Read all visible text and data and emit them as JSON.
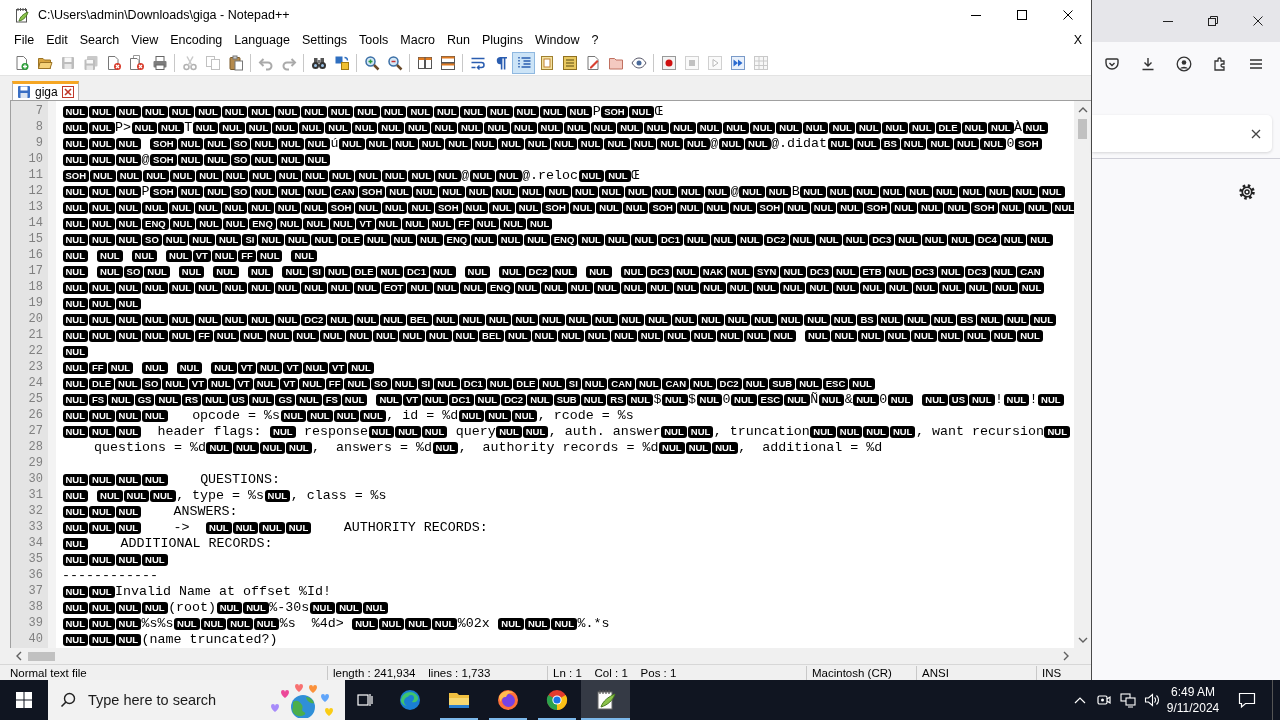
{
  "window": {
    "title": "C:\\Users\\admin\\Downloads\\giga - Notepad++"
  },
  "menu": {
    "items": [
      "File",
      "Edit",
      "Search",
      "View",
      "Encoding",
      "Language",
      "Settings",
      "Tools",
      "Macro",
      "Run",
      "Plugins",
      "Window",
      "?"
    ],
    "close_label": "X"
  },
  "toolbar": [
    {
      "pressed": false,
      "disabled": false
    },
    {
      "pressed": false,
      "disabled": false
    },
    {
      "pressed": false,
      "disabled": true
    },
    {
      "pressed": false,
      "disabled": true
    },
    {
      "pressed": false,
      "disabled": false
    },
    {
      "pressed": false,
      "disabled": false
    },
    {
      "pressed": false,
      "disabled": false
    },
    {
      "pressed": false,
      "disabled": true
    },
    {
      "pressed": false,
      "disabled": true
    },
    {
      "pressed": false,
      "disabled": false
    },
    {
      "pressed": false,
      "disabled": true
    },
    {
      "pressed": false,
      "disabled": true
    },
    {
      "pressed": false,
      "disabled": false
    },
    {
      "pressed": false,
      "disabled": false
    },
    {
      "pressed": false,
      "disabled": false
    },
    {
      "pressed": false,
      "disabled": false
    },
    {
      "pressed": false,
      "disabled": false
    },
    {
      "pressed": false,
      "disabled": false
    },
    {
      "pressed": false,
      "disabled": false
    },
    {
      "pressed": false,
      "disabled": false
    },
    {
      "pressed": true,
      "disabled": false
    },
    {
      "pressed": false,
      "disabled": false
    },
    {
      "pressed": false,
      "disabled": false
    },
    {
      "pressed": false,
      "disabled": false
    },
    {
      "pressed": false,
      "disabled": false
    },
    {
      "pressed": false,
      "disabled": false
    },
    {
      "pressed": false,
      "disabled": false
    },
    {
      "pressed": false,
      "disabled": true
    },
    {
      "pressed": false,
      "disabled": true
    },
    {
      "pressed": false,
      "disabled": false
    },
    {
      "pressed": false,
      "disabled": true
    }
  ],
  "tabs": [
    {
      "label": "giga",
      "selected": true
    }
  ],
  "editor": {
    "lines": [
      {
        "number": "7",
        "segments": [
          {
            "kind": "ctrl",
            "codes": [
              "NUL",
              "NUL",
              "NUL",
              "NUL",
              "NUL",
              "NUL",
              "NUL",
              "NUL",
              "NUL",
              "NUL",
              "NUL",
              "NUL",
              "NUL",
              "NUL",
              "NUL",
              "NUL",
              "NUL",
              "NUL",
              "NUL",
              "NUL"
            ]
          },
          {
            "kind": "text",
            "text": "P"
          },
          {
            "kind": "ctrl",
            "codes": [
              "SOH",
              "NUL"
            ]
          },
          {
            "kind": "text",
            "text": "Œ"
          }
        ]
      },
      {
        "number": "8",
        "segments": [
          {
            "kind": "ctrl",
            "codes": [
              "NUL",
              "NUL"
            ]
          },
          {
            "kind": "text",
            "text": "P>"
          },
          {
            "kind": "ctrl",
            "codes": [
              "NUL",
              "NUL"
            ]
          },
          {
            "kind": "text",
            "text": "T"
          },
          {
            "kind": "ctrl",
            "codes": [
              "NUL",
              "NUL",
              "NUL",
              "NUL",
              "NUL",
              "NUL",
              "NUL",
              "NUL",
              "NUL",
              "NUL",
              "NUL",
              "NUL",
              "NUL",
              "NUL",
              "NUL",
              "NUL",
              "NUL",
              "NUL",
              "NUL",
              "NUL",
              "NUL",
              "NUL",
              "NUL",
              "NUL",
              "NUL",
              "NUL",
              "NUL",
              "NUL",
              "DLE",
              "NUL",
              "NUL"
            ]
          },
          {
            "kind": "text",
            "text": "À"
          },
          {
            "kind": "ctrl",
            "codes": [
              "NUL"
            ]
          }
        ]
      },
      {
        "number": "9",
        "segments": [
          {
            "kind": "ctrl",
            "codes": [
              "NUL",
              "NUL",
              "NUL"
            ]
          },
          {
            "kind": "ctrl",
            "codes": [
              "SOH",
              "NUL",
              "NUL",
              "SO",
              "NUL",
              "NUL",
              "NUL"
            ]
          },
          {
            "kind": "text",
            "text": "ú"
          },
          {
            "kind": "ctrl",
            "codes": [
              "NUL",
              "NUL",
              "NUL",
              "NUL",
              "NUL",
              "NUL",
              "NUL",
              "NUL",
              "NUL",
              "NUL",
              "NUL",
              "NUL",
              "NUL",
              "NUL"
            ]
          },
          {
            "kind": "text",
            "text": "@"
          },
          {
            "kind": "ctrl",
            "codes": [
              "NUL",
              "NUL"
            ]
          },
          {
            "kind": "text",
            "text": "@.didat"
          },
          {
            "kind": "ctrl",
            "codes": [
              "NUL",
              "NUL",
              "BS",
              "NUL",
              "NUL",
              "NUL",
              "NUL"
            ]
          },
          {
            "kind": "text",
            "text": "0"
          },
          {
            "kind": "ctrl",
            "codes": [
              "SOH"
            ]
          }
        ]
      },
      {
        "number": "10",
        "segments": [
          {
            "kind": "ctrl",
            "codes": [
              "NUL",
              "NUL",
              "NUL"
            ]
          },
          {
            "kind": "text",
            "text": "@"
          },
          {
            "kind": "ctrl",
            "codes": [
              "SOH",
              "NUL",
              "NUL",
              "SO",
              "NUL",
              "NUL",
              "NUL"
            ]
          }
        ]
      },
      {
        "number": "11",
        "segments": [
          {
            "kind": "ctrl",
            "codes": [
              "SOH",
              "NUL",
              "NUL",
              "NUL",
              "NUL",
              "NUL",
              "NUL",
              "NUL",
              "NUL",
              "NUL",
              "NUL",
              "NUL",
              "NUL",
              "NUL",
              "NUL"
            ]
          },
          {
            "kind": "text",
            "text": "@"
          },
          {
            "kind": "ctrl",
            "codes": [
              "NUL",
              "NUL"
            ]
          },
          {
            "kind": "text",
            "text": "@.reloc"
          },
          {
            "kind": "ctrl",
            "codes": [
              "NUL",
              "NUL"
            ]
          },
          {
            "kind": "text",
            "text": "Œ"
          }
        ]
      },
      {
        "number": "12",
        "segments": [
          {
            "kind": "ctrl",
            "codes": [
              "NUL",
              "NUL",
              "NUL"
            ]
          },
          {
            "kind": "text",
            "text": "P"
          },
          {
            "kind": "ctrl",
            "codes": [
              "SOH",
              "NUL",
              "NUL",
              "SO",
              "NUL",
              "NUL",
              "NUL",
              "CAN",
              "SOH",
              "NUL",
              "NUL",
              "NUL",
              "NUL",
              "NUL",
              "NUL",
              "NUL",
              "NUL",
              "NUL",
              "NUL",
              "NUL",
              "NUL",
              "NUL"
            ]
          },
          {
            "kind": "text",
            "text": "@"
          },
          {
            "kind": "ctrl",
            "codes": [
              "NUL",
              "NUL"
            ]
          },
          {
            "kind": "text",
            "text": "B"
          },
          {
            "kind": "ctrl",
            "codes": [
              "NUL",
              "NUL",
              "NUL",
              "NUL",
              "NUL",
              "NUL",
              "NUL",
              "NUL",
              "NUL",
              "NUL"
            ]
          }
        ]
      },
      {
        "number": "13",
        "segments": [
          {
            "kind": "ctrl",
            "codes": [
              "NUL",
              "NUL",
              "NUL",
              "NUL",
              "NUL",
              "NUL",
              "NUL",
              "NUL",
              "NUL",
              "NUL",
              "SOH",
              "NUL",
              "NUL",
              "NUL",
              "SOH",
              "NUL",
              "NUL",
              "NUL",
              "SOH",
              "NUL",
              "NUL",
              "NUL",
              "SOH",
              "NUL",
              "NUL",
              "NUL",
              "SOH",
              "NUL",
              "NUL",
              "NUL",
              "SOH",
              "NUL",
              "NUL",
              "NUL",
              "SOH",
              "NUL",
              "NUL",
              "NUL"
            ]
          }
        ]
      },
      {
        "number": "14",
        "segments": [
          {
            "kind": "ctrl",
            "codes": [
              "NUL",
              "NUL",
              "NUL",
              "ENQ",
              "NUL",
              "NUL",
              "NUL",
              "ENQ",
              "NUL",
              "NUL",
              "NUL",
              "VT",
              "NUL",
              "NUL",
              "NUL",
              "FF",
              "NUL",
              "NUL",
              "NUL"
            ]
          }
        ]
      },
      {
        "number": "15",
        "segments": [
          {
            "kind": "ctrl",
            "codes": [
              "NUL",
              "NUL",
              "NUL",
              "SO",
              "NUL",
              "NUL",
              "NUL",
              "SI",
              "NUL",
              "NUL",
              "NUL",
              "DLE",
              "NUL",
              "NUL",
              "NUL",
              "ENQ",
              "NUL",
              "NUL",
              "NUL",
              "ENQ",
              "NUL",
              "NUL",
              "NUL",
              "DC1",
              "NUL",
              "NUL",
              "NUL",
              "DC2",
              "NUL",
              "NUL",
              "NUL",
              "DC3",
              "NUL",
              "NUL",
              "NUL",
              "DC4",
              "NUL",
              "NUL"
            ]
          }
        ]
      },
      {
        "number": "16",
        "segments": [
          {
            "kind": "ctrl",
            "codes": [
              "NUL"
            ]
          },
          {
            "kind": "ctrl",
            "codes": [
              "NUL"
            ]
          },
          {
            "kind": "ctrl",
            "codes": [
              "NUL"
            ]
          },
          {
            "kind": "ctrl",
            "codes": [
              "NUL",
              "VT",
              "NUL",
              "FF",
              "NUL"
            ]
          },
          {
            "kind": "ctrl",
            "codes": [
              "NUL"
            ]
          }
        ]
      },
      {
        "number": "17",
        "segments": [
          {
            "kind": "ctrl",
            "codes": [
              "NUL"
            ]
          },
          {
            "kind": "ctrl",
            "codes": [
              "NUL",
              "SO",
              "NUL"
            ]
          },
          {
            "kind": "ctrl",
            "codes": [
              "NUL"
            ]
          },
          {
            "kind": "ctrl",
            "codes": [
              "NUL"
            ]
          },
          {
            "kind": "ctrl",
            "codes": [
              "NUL"
            ]
          },
          {
            "kind": "ctrl",
            "codes": [
              "NUL",
              "SI",
              "NUL",
              "DLE",
              "NUL",
              "DC1",
              "NUL"
            ]
          },
          {
            "kind": "ctrl",
            "codes": [
              "NUL"
            ]
          },
          {
            "kind": "ctrl",
            "codes": [
              "NUL",
              "DC2",
              "NUL"
            ]
          },
          {
            "kind": "ctrl",
            "codes": [
              "NUL"
            ]
          },
          {
            "kind": "ctrl",
            "codes": [
              "NUL",
              "DC3",
              "NUL",
              "NAK",
              "NUL",
              "SYN",
              "NUL",
              "DC3",
              "NUL",
              "ETB",
              "NUL",
              "DC3",
              "NUL",
              "DC3",
              "NUL",
              "CAN"
            ]
          }
        ]
      },
      {
        "number": "18",
        "segments": [
          {
            "kind": "ctrl",
            "codes": [
              "NUL",
              "NUL",
              "NUL",
              "NUL",
              "NUL",
              "NUL",
              "NUL",
              "NUL",
              "NUL",
              "NUL",
              "NUL",
              "NUL",
              "EOT",
              "NUL",
              "NUL",
              "NUL",
              "ENQ",
              "NUL",
              "NUL",
              "NUL",
              "NUL",
              "NUL",
              "NUL",
              "NUL",
              "NUL",
              "NUL",
              "NUL",
              "NUL",
              "NUL",
              "NUL",
              "NUL",
              "NUL",
              "NUL",
              "NUL",
              "NUL",
              "NUL",
              "NUL"
            ]
          }
        ]
      },
      {
        "number": "19",
        "segments": [
          {
            "kind": "ctrl",
            "codes": [
              "NUL",
              "NUL",
              "NUL"
            ]
          }
        ]
      },
      {
        "number": "20",
        "segments": [
          {
            "kind": "ctrl",
            "codes": [
              "NUL",
              "NUL",
              "NUL",
              "NUL",
              "NUL",
              "NUL",
              "NUL",
              "NUL",
              "NUL",
              "DC2",
              "NUL",
              "NUL",
              "NUL",
              "BEL",
              "NUL",
              "NUL",
              "NUL",
              "NUL",
              "NUL",
              "NUL",
              "NUL",
              "NUL",
              "NUL",
              "NUL",
              "NUL",
              "NUL",
              "NUL",
              "NUL",
              "NUL",
              "NUL",
              "BS",
              "NUL",
              "NUL",
              "NUL",
              "BS",
              "NUL",
              "NUL",
              "NUL"
            ]
          }
        ]
      },
      {
        "number": "21",
        "segments": [
          {
            "kind": "ctrl",
            "codes": [
              "NUL",
              "NUL",
              "NUL",
              "NUL",
              "NUL",
              "FF",
              "NUL",
              "NUL",
              "NUL",
              "NUL",
              "NUL",
              "NUL",
              "NUL",
              "NUL",
              "NUL",
              "NUL",
              "BEL",
              "NUL",
              "NUL",
              "NUL",
              "NUL",
              "NUL",
              "NUL",
              "NUL",
              "NUL",
              "NUL",
              "NUL",
              "NUL"
            ]
          },
          {
            "kind": "ctrl",
            "codes": [
              "NUL",
              "NUL",
              "NUL",
              "NUL",
              "NUL",
              "NUL",
              "NUL",
              "NUL",
              "NUL"
            ]
          }
        ]
      },
      {
        "number": "22",
        "segments": [
          {
            "kind": "ctrl",
            "codes": [
              "NUL"
            ]
          }
        ]
      },
      {
        "number": "23",
        "segments": [
          {
            "kind": "ctrl",
            "codes": [
              "NUL",
              "FF",
              "NUL"
            ]
          },
          {
            "kind": "ctrl",
            "codes": [
              "NUL"
            ]
          },
          {
            "kind": "ctrl",
            "codes": [
              "NUL"
            ]
          },
          {
            "kind": "ctrl",
            "codes": [
              "NUL",
              "VT",
              "NUL",
              "VT",
              "NUL",
              "VT",
              "NUL"
            ]
          }
        ]
      },
      {
        "number": "24",
        "segments": [
          {
            "kind": "ctrl",
            "codes": [
              "NUL",
              "DLE",
              "NUL",
              "SO",
              "NUL",
              "VT",
              "NUL",
              "VT",
              "NUL",
              "VT",
              "NUL",
              "FF",
              "NUL",
              "SO",
              "NUL",
              "SI",
              "NUL",
              "DC1",
              "NUL",
              "DLE",
              "NUL",
              "SI",
              "NUL",
              "CAN",
              "NUL",
              "CAN",
              "NUL",
              "DC2",
              "NUL",
              "SUB",
              "NUL",
              "ESC",
              "NUL"
            ]
          }
        ]
      },
      {
        "number": "25",
        "segments": [
          {
            "kind": "ctrl",
            "codes": [
              "NUL",
              "FS",
              "NUL",
              "GS",
              "NUL",
              "RS",
              "NUL",
              "US",
              "NUL",
              "GS",
              "NUL",
              "FS",
              "NUL"
            ]
          },
          {
            "kind": "ctrl",
            "codes": [
              "NUL",
              "VT",
              "NUL",
              "DC1",
              "NUL",
              "DC2",
              "NUL",
              "SUB",
              "NUL",
              "RS",
              "NUL"
            ]
          },
          {
            "kind": "text",
            "text": "$"
          },
          {
            "kind": "ctrl",
            "codes": [
              "NUL"
            ]
          },
          {
            "kind": "text",
            "text": "$"
          },
          {
            "kind": "ctrl",
            "codes": [
              "NUL"
            ]
          },
          {
            "kind": "text",
            "text": "0"
          },
          {
            "kind": "ctrl",
            "codes": [
              "NUL",
              "ESC",
              "NUL"
            ]
          },
          {
            "kind": "text",
            "text": "Ñ"
          },
          {
            "kind": "ctrl",
            "codes": [
              "NUL"
            ]
          },
          {
            "kind": "text",
            "text": "&"
          },
          {
            "kind": "ctrl",
            "codes": [
              "NUL"
            ]
          },
          {
            "kind": "text",
            "text": "0"
          },
          {
            "kind": "ctrl",
            "codes": [
              "NUL"
            ]
          },
          {
            "kind": "ctrl",
            "codes": [
              "NUL",
              "US",
              "NUL"
            ]
          },
          {
            "kind": "text",
            "text": "!"
          },
          {
            "kind": "ctrl",
            "codes": [
              "NUL"
            ]
          },
          {
            "kind": "text",
            "text": "!"
          },
          {
            "kind": "ctrl",
            "codes": [
              "NUL"
            ]
          }
        ]
      },
      {
        "number": "26",
        "segments": [
          {
            "kind": "ctrl",
            "codes": [
              "NUL",
              "NUL",
              "NUL",
              "NUL"
            ]
          },
          {
            "kind": "text",
            "text": "   opcode = %s"
          },
          {
            "kind": "ctrl",
            "codes": [
              "NUL",
              "NUL",
              "NUL",
              "NUL"
            ]
          },
          {
            "kind": "text",
            "text": ", id = %d"
          },
          {
            "kind": "ctrl",
            "codes": [
              "NUL",
              "NUL",
              "NUL"
            ]
          },
          {
            "kind": "text",
            "text": ", rcode = %s"
          }
        ]
      },
      {
        "number": "27",
        "segments": [
          {
            "kind": "ctrl",
            "codes": [
              "NUL",
              "NUL",
              "NUL"
            ]
          },
          {
            "kind": "text",
            "text": "  header flags: "
          },
          {
            "kind": "ctrl",
            "codes": [
              "NUL"
            ]
          },
          {
            "kind": "text",
            "text": " response"
          },
          {
            "kind": "ctrl",
            "codes": [
              "NUL",
              "NUL",
              "NUL"
            ]
          },
          {
            "kind": "text",
            "text": " query"
          },
          {
            "kind": "ctrl",
            "codes": [
              "NUL",
              "NUL"
            ]
          },
          {
            "kind": "text",
            "text": ", auth. answer"
          },
          {
            "kind": "ctrl",
            "codes": [
              "NUL",
              "NUL"
            ]
          },
          {
            "kind": "text",
            "text": ", truncation"
          },
          {
            "kind": "ctrl",
            "codes": [
              "NUL",
              "NUL",
              "NUL",
              "NUL"
            ]
          },
          {
            "kind": "text",
            "text": ", want recursion"
          },
          {
            "kind": "ctrl",
            "codes": [
              "NUL"
            ]
          }
        ]
      },
      {
        "number": "28",
        "segments": [
          {
            "kind": "text",
            "text": "    questions = %d"
          },
          {
            "kind": "ctrl",
            "codes": [
              "NUL",
              "NUL",
              "NUL",
              "NUL"
            ]
          },
          {
            "kind": "text",
            "text": ",  answers = %d"
          },
          {
            "kind": "ctrl",
            "codes": [
              "NUL"
            ]
          },
          {
            "kind": "text",
            "text": ",  authority records = %d"
          },
          {
            "kind": "ctrl",
            "codes": [
              "NUL",
              "NUL",
              "NUL"
            ]
          },
          {
            "kind": "text",
            "text": ",  additional = %d"
          }
        ]
      },
      {
        "number": "29"
      },
      {
        "number": "30",
        "segments": [
          {
            "kind": "ctrl",
            "codes": [
              "NUL",
              "NUL",
              "NUL",
              "NUL"
            ]
          },
          {
            "kind": "text",
            "text": "    QUESTIONS:"
          }
        ]
      },
      {
        "number": "31",
        "segments": [
          {
            "kind": "ctrl",
            "codes": [
              "NUL"
            ]
          },
          {
            "kind": "ctrl",
            "codes": [
              "NUL",
              "NUL",
              "NUL"
            ]
          },
          {
            "kind": "text",
            "text": ", type = %s"
          },
          {
            "kind": "ctrl",
            "codes": [
              "NUL"
            ]
          },
          {
            "kind": "text",
            "text": ", class = %s"
          }
        ]
      },
      {
        "number": "32",
        "segments": [
          {
            "kind": "ctrl",
            "codes": [
              "NUL",
              "NUL",
              "NUL"
            ]
          },
          {
            "kind": "text",
            "text": "    ANSWERS:"
          }
        ]
      },
      {
        "number": "33",
        "segments": [
          {
            "kind": "ctrl",
            "codes": [
              "NUL",
              "NUL",
              "NUL"
            ]
          },
          {
            "kind": "text",
            "text": "    ->  "
          },
          {
            "kind": "ctrl",
            "codes": [
              "NUL",
              "NUL",
              "NUL",
              "NUL"
            ]
          },
          {
            "kind": "text",
            "text": "    AUTHORITY RECORDS:"
          }
        ]
      },
      {
        "number": "34",
        "segments": [
          {
            "kind": "ctrl",
            "codes": [
              "NUL"
            ]
          },
          {
            "kind": "text",
            "text": "    ADDITIONAL RECORDS:"
          }
        ]
      },
      {
        "number": "35",
        "segments": [
          {
            "kind": "ctrl",
            "codes": [
              "NUL",
              "NUL",
              "NUL",
              "NUL"
            ]
          }
        ]
      },
      {
        "number": "36",
        "segments": [
          {
            "kind": "text",
            "text": "------------"
          }
        ]
      },
      {
        "number": "37",
        "segments": [
          {
            "kind": "ctrl",
            "codes": [
              "NUL",
              "NUL"
            ]
          },
          {
            "kind": "text",
            "text": "Invalid Name at offset %Id!"
          }
        ]
      },
      {
        "number": "38",
        "segments": [
          {
            "kind": "ctrl",
            "codes": [
              "NUL",
              "NUL",
              "NUL",
              "NUL"
            ]
          },
          {
            "kind": "text",
            "text": "(root)"
          },
          {
            "kind": "ctrl",
            "codes": [
              "NUL",
              "NUL"
            ]
          },
          {
            "kind": "text",
            "text": "%-30s"
          },
          {
            "kind": "ctrl",
            "codes": [
              "NUL",
              "NUL",
              "NUL"
            ]
          }
        ]
      },
      {
        "number": "39",
        "segments": [
          {
            "kind": "ctrl",
            "codes": [
              "NUL",
              "NUL",
              "NUL"
            ]
          },
          {
            "kind": "text",
            "text": "%s%s"
          },
          {
            "kind": "ctrl",
            "codes": [
              "NUL",
              "NUL",
              "NUL",
              "NUL"
            ]
          },
          {
            "kind": "text",
            "text": "%s  %4d> "
          },
          {
            "kind": "ctrl",
            "codes": [
              "NUL",
              "NUL",
              "NUL",
              "NUL"
            ]
          },
          {
            "kind": "text",
            "text": "%02x "
          },
          {
            "kind": "ctrl",
            "codes": [
              "NUL",
              "NUL",
              "NUL"
            ]
          },
          {
            "kind": "text",
            "text": "%.*s"
          }
        ]
      },
      {
        "number": "40",
        "segments": [
          {
            "kind": "ctrl",
            "codes": [
              "NUL",
              "NUL",
              "NUL"
            ]
          },
          {
            "kind": "text",
            "text": "(name truncated?)"
          }
        ]
      }
    ]
  },
  "status_bar": [
    "Normal text file",
    "length : 241,934    lines : 1,733",
    "Ln : 1    Col : 1    Pos : 1",
    "Macintosh (CR)",
    "ANSI",
    "INS"
  ],
  "taskbar": {
    "search": {
      "placeholder": "Type here to search"
    },
    "apps": [
      {
        "running": false,
        "selected": false
      },
      {
        "running": true,
        "selected": false
      },
      {
        "running": true,
        "selected": false
      },
      {
        "running": true,
        "selected": false
      },
      {
        "running": true,
        "selected": true
      }
    ],
    "time": "6:49 AM",
    "date": "9/11/2024"
  }
}
